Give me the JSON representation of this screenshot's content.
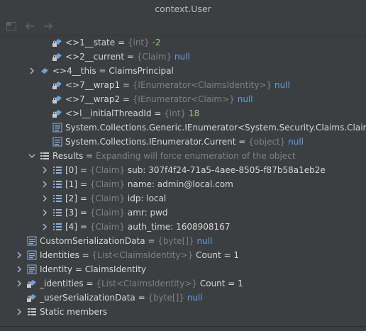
{
  "window": {
    "title": "context.User"
  },
  "colors": {
    "background": "#3c3f41",
    "keyword": "#5e9ee8",
    "number": "#9fc97f",
    "type": "#808080",
    "text": "#d7d7d7"
  },
  "toolbar": {
    "icons": [
      "layout-icon",
      "back-arrow-icon",
      "forward-arrow-icon"
    ]
  },
  "rows": [
    {
      "arrow": "",
      "icon": "field-lock-icon",
      "name": "<>1__state",
      "eq": " = ",
      "type": "{int} ",
      "value": "-2",
      "valueClass": "num"
    },
    {
      "arrow": "",
      "icon": "field-lock-icon",
      "name": "<>2__current",
      "eq": " = ",
      "type": "{Claim} ",
      "value": "null",
      "valueClass": "kw"
    },
    {
      "arrow": "›",
      "icon": "field-icon",
      "name": "<>4__this",
      "eq": " = ",
      "type": "",
      "value": "ClaimsPrincipal",
      "valueClass": "val"
    },
    {
      "arrow": "",
      "icon": "field-lock-icon",
      "name": "<>7__wrap1",
      "eq": " = ",
      "type": "{IEnumerator<ClaimsIdentity>} ",
      "value": "null",
      "valueClass": "kw"
    },
    {
      "arrow": "",
      "icon": "field-lock-icon",
      "name": "<>7__wrap2",
      "eq": " = ",
      "type": "{IEnumerator<Claim>} ",
      "value": "null",
      "valueClass": "kw"
    },
    {
      "arrow": "",
      "icon": "field-lock-icon",
      "name": "<>l__initialThreadId",
      "eq": " = ",
      "type": "{int} ",
      "value": "18",
      "valueClass": "num"
    },
    {
      "arrow": "",
      "icon": "property-icon",
      "name": "System.Collections.Generic.IEnumerator<System.Security.Claims.Claim>.C",
      "eq": "",
      "type": "",
      "value": "",
      "valueClass": "val"
    },
    {
      "arrow": "",
      "icon": "property-icon",
      "name": "System.Collections.IEnumerator.Current",
      "eq": " = ",
      "type": "{object} ",
      "value": "null",
      "valueClass": "kw"
    },
    {
      "arrow": "⌄",
      "icon": "results-icon",
      "name": "Results",
      "eq": " = ",
      "type": "Expanding will force enumeration of the object",
      "value": "",
      "valueClass": "val"
    },
    {
      "arrow": "›",
      "icon": "array-item-icon",
      "name": "[0]",
      "eq": " = ",
      "type": "{Claim} ",
      "value": "sub: 307f4f24-71a5-4aee-8505-f87b58a1eb2e",
      "valueClass": "val"
    },
    {
      "arrow": "›",
      "icon": "array-item-icon",
      "name": "[1]",
      "eq": " = ",
      "type": "{Claim} ",
      "value": "name: admin@local.com",
      "valueClass": "val"
    },
    {
      "arrow": "›",
      "icon": "array-item-icon",
      "name": "[2]",
      "eq": " = ",
      "type": "{Claim} ",
      "value": "idp: local",
      "valueClass": "val"
    },
    {
      "arrow": "›",
      "icon": "array-item-icon",
      "name": "[3]",
      "eq": " = ",
      "type": "{Claim} ",
      "value": "amr: pwd",
      "valueClass": "val"
    },
    {
      "arrow": "›",
      "icon": "array-item-icon",
      "name": "[4]",
      "eq": " = ",
      "type": "{Claim} ",
      "value": "auth_time: 1608908167",
      "valueClass": "val"
    },
    {
      "arrow": "",
      "icon": "property-icon",
      "name": "CustomSerializationData",
      "eq": " = ",
      "type": "{byte[]} ",
      "value": "null",
      "valueClass": "kw"
    },
    {
      "arrow": "›",
      "icon": "property-icon",
      "name": "Identities",
      "eq": " = ",
      "type": "{List<ClaimsIdentity>} ",
      "value": "Count = 1",
      "valueClass": "val"
    },
    {
      "arrow": "›",
      "icon": "property-icon",
      "name": "Identity",
      "eq": " = ",
      "type": "",
      "value": "ClaimsIdentity",
      "valueClass": "val"
    },
    {
      "arrow": "›",
      "icon": "field-lock-icon",
      "name": "_identities",
      "eq": " = ",
      "type": "{List<ClaimsIdentity>} ",
      "value": "Count = 1",
      "valueClass": "val"
    },
    {
      "arrow": "",
      "icon": "field-lock-icon",
      "name": "_userSerializationData",
      "eq": " = ",
      "type": "{byte[]} ",
      "value": "null",
      "valueClass": "kw"
    },
    {
      "arrow": "›",
      "icon": "static-members-icon",
      "name": "Static members",
      "eq": "",
      "type": "",
      "value": "",
      "valueClass": "val"
    }
  ]
}
